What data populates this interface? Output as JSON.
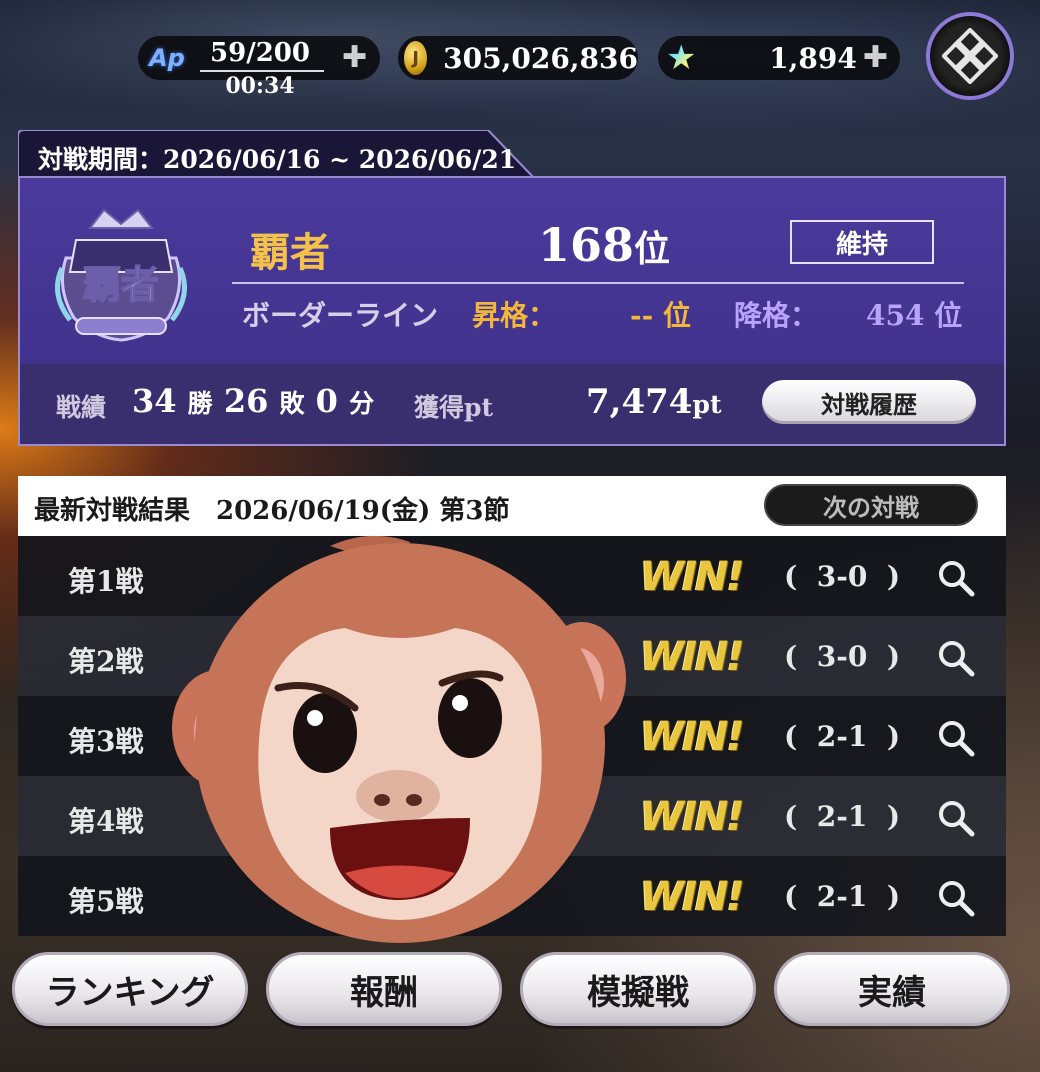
{
  "header": {
    "ap_icon": "Ap",
    "ap_value": "59/200",
    "ap_timer": "00:34",
    "coin_icon": "coin-icon",
    "coins": "305,026,836",
    "star_icon": "star-gem-icon",
    "stars": "1,894",
    "plus_label": "✚",
    "menu_icon": "knot-emblem-icon"
  },
  "period": {
    "label": "対戦期間：2026/06/16 ~ 2026/06/21"
  },
  "rank": {
    "class_name": "覇者",
    "rank_number": "168",
    "rank_unit": "位",
    "status": "維持",
    "border_label": "ボーダーライン",
    "promotion_label": "昇格：",
    "promotion_value": "-- 位",
    "demotion_label": "降格：",
    "demotion_value": "454 位",
    "emblem_text": "覇者"
  },
  "record": {
    "label": "戦績",
    "wins": "34",
    "wins_unit": "勝",
    "losses": "26",
    "losses_unit": "敗",
    "draws": "0",
    "draws_unit": "分",
    "points_label": "獲得pt",
    "points_value": "7,474",
    "points_unit": "pt",
    "history_button": "対戦履歴"
  },
  "latest": {
    "title": "最新対戦結果　2026/06/19(金) 第3節",
    "next_button": "次の対戦",
    "battles": [
      {
        "label": "第1戦",
        "result": "WIN!",
        "score": "(  3-0  )"
      },
      {
        "label": "第2戦",
        "result": "WIN!",
        "score": "(  3-0  )"
      },
      {
        "label": "第3戦",
        "result": "WIN!",
        "score": "(  2-1  )"
      },
      {
        "label": "第4戦",
        "result": "WIN!",
        "score": "(  2-1  )"
      },
      {
        "label": "第5戦",
        "result": "WIN!",
        "score": "(  2-1  )"
      }
    ]
  },
  "nav": {
    "ranking": "ランキング",
    "reward": "報酬",
    "mock_battle": "模擬戦",
    "achievements": "実績"
  },
  "colors": {
    "panel_purple": "#3d2f86",
    "gold": "#f4c24a",
    "demotion": "#b8a4ff",
    "win": "#e9c640"
  }
}
